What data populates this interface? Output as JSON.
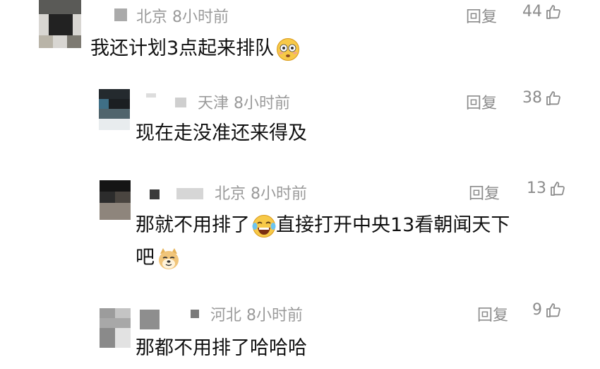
{
  "comments": [
    {
      "location": "北京",
      "time": "8小时前",
      "reply_label": "回复",
      "likes": "44",
      "text": "我还计划3点起来排队",
      "emoji": "flushed-face-emoji"
    },
    {
      "location": "天津",
      "time": "8小时前",
      "reply_label": "回复",
      "likes": "38",
      "text": "现在走没准还来得及"
    },
    {
      "location": "北京",
      "time": "8小时前",
      "reply_label": "回复",
      "likes": "13",
      "text_part1": "那就不用排了",
      "emoji1": "laughing-tears-emoji",
      "text_part2": "直接打开中央13看朝闻天下",
      "text_line2": "吧",
      "emoji2": "doge-emoji"
    },
    {
      "location": "河北",
      "time": "8小时前",
      "reply_label": "回复",
      "likes": "9",
      "text": "那都不用排了哈哈哈"
    }
  ],
  "icons": {
    "like": "thumbs-up-icon"
  },
  "colors": {
    "meta_text": "#9a9a9a",
    "body_text": "#111111",
    "background": "#ffffff"
  }
}
